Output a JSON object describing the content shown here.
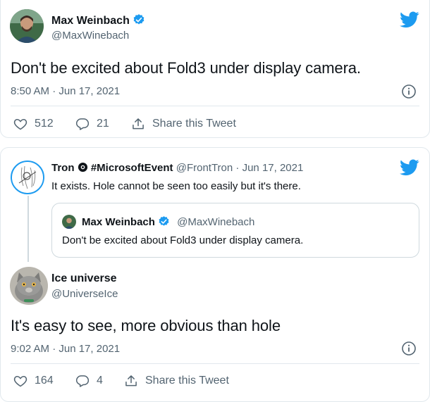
{
  "tweet": {
    "author": {
      "name": "Max Weinbach",
      "handle": "@MaxWinebach",
      "verified": true
    },
    "text": "Don't be excited about Fold3 under display camera.",
    "timestamp": "8:50 AM · Jun 17, 2021",
    "actions": {
      "likes": "512",
      "replies": "21",
      "share_label": "Share this Tweet"
    }
  },
  "thread": {
    "reply": {
      "author": {
        "name": "Tron",
        "display_suffix": "#MicrosoftEvent",
        "handle": "@FrontTron",
        "date": "Jun 17, 2021"
      },
      "text": "It exists. Hole cannot be seen too easily but it's there."
    },
    "quote": {
      "author": {
        "name": "Max Weinbach",
        "handle": "@MaxWinebach",
        "verified": true
      },
      "text": "Don't be excited about Fold3 under display camera."
    },
    "main": {
      "author": {
        "name": "Ice universe",
        "handle": "@UniverseIce"
      },
      "text": "It's easy to see, more obvious than hole",
      "timestamp": "9:02 AM · Jun 17, 2021",
      "actions": {
        "likes": "164",
        "replies": "4",
        "share_label": "Share this Tweet"
      }
    }
  },
  "colors": {
    "twitter_blue": "#1d9bf0",
    "text": "#0f1419",
    "secondary": "#536471",
    "border": "#e1e8ed"
  },
  "icons": [
    "twitter-bird-icon",
    "verified-badge-icon",
    "info-icon",
    "heart-icon",
    "reply-icon",
    "share-icon",
    "sun-icon"
  ]
}
